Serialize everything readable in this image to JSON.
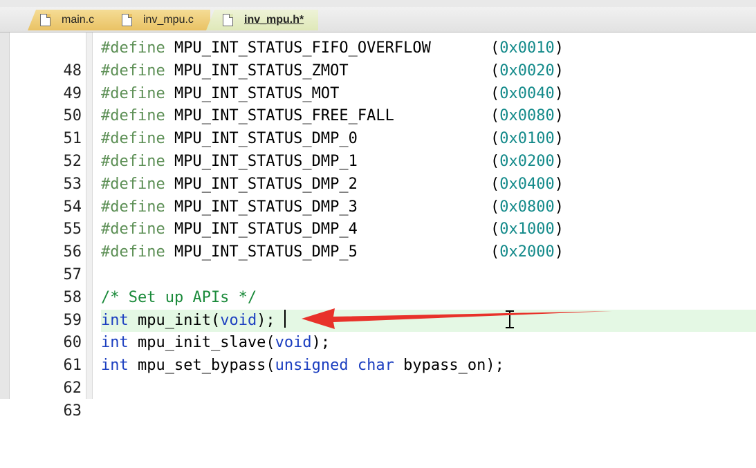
{
  "tabs": [
    {
      "label": "main.c",
      "active": false
    },
    {
      "label": "inv_mpu.c",
      "active": false
    },
    {
      "label": "inv_mpu.h*",
      "active": true
    }
  ],
  "editor": {
    "highlighted_line": 60,
    "lines": [
      {
        "num": "48",
        "pp": "#define",
        "name": " MPU_INT_STATUS_FIFO_OVERFLOW",
        "open": "(",
        "val": "0x0010",
        "close": ")"
      },
      {
        "num": "49",
        "pp": "#define",
        "name": " MPU_INT_STATUS_ZMOT",
        "open": "(",
        "val": "0x0020",
        "close": ")"
      },
      {
        "num": "50",
        "pp": "#define",
        "name": " MPU_INT_STATUS_MOT",
        "open": "(",
        "val": "0x0040",
        "close": ")"
      },
      {
        "num": "51",
        "pp": "#define",
        "name": " MPU_INT_STATUS_FREE_FALL",
        "open": "(",
        "val": "0x0080",
        "close": ")"
      },
      {
        "num": "52",
        "pp": "#define",
        "name": " MPU_INT_STATUS_DMP_0",
        "open": "(",
        "val": "0x0100",
        "close": ")"
      },
      {
        "num": "53",
        "pp": "#define",
        "name": " MPU_INT_STATUS_DMP_1",
        "open": "(",
        "val": "0x0200",
        "close": ")"
      },
      {
        "num": "54",
        "pp": "#define",
        "name": " MPU_INT_STATUS_DMP_2",
        "open": "(",
        "val": "0x0400",
        "close": ")"
      },
      {
        "num": "55",
        "pp": "#define",
        "name": " MPU_INT_STATUS_DMP_3",
        "open": "(",
        "val": "0x0800",
        "close": ")"
      },
      {
        "num": "56",
        "pp": "#define",
        "name": " MPU_INT_STATUS_DMP_4",
        "open": "(",
        "val": "0x1000",
        "close": ")"
      },
      {
        "num": "57",
        "pp": "#define",
        "name": " MPU_INT_STATUS_DMP_5",
        "open": "(",
        "val": "0x2000",
        "close": ")"
      }
    ],
    "line58": {
      "num": "58"
    },
    "line59": {
      "num": "59",
      "comment": "/* Set up APIs */"
    },
    "line60": {
      "num": "60",
      "t1": "int",
      "t2": " mpu_init(",
      "t3": "void",
      "t4": ");"
    },
    "line61": {
      "num": "61",
      "t1": "int",
      "t2": " mpu_init_slave(",
      "t3": "void",
      "t4": ");"
    },
    "line62": {
      "num": "62",
      "t1": "int",
      "t2": " mpu_set_bypass(",
      "t3": "unsigned",
      "t4": " ",
      "t5": "char",
      "t6": " bypass_on);"
    },
    "line63": {
      "num": "63"
    }
  },
  "colors": {
    "preprocessor": "#5c8f55",
    "keyword": "#1c3fc0",
    "number": "#138a8a",
    "comment": "#1a8a3a",
    "highlight": "#e4f8e4",
    "annotation_arrow": "#e8322a"
  }
}
